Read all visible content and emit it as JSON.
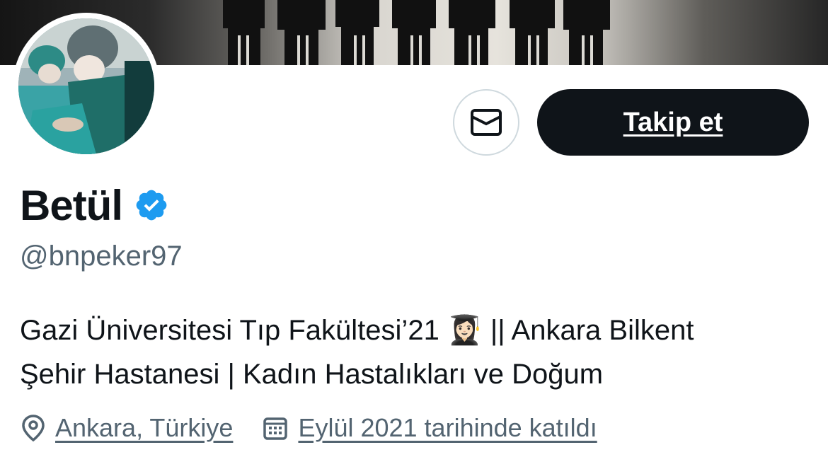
{
  "profile": {
    "display_name": "Betül",
    "handle": "@bnpeker97",
    "verified_icon": "verified-badge-icon",
    "bio_line1": "Gazi Üniversitesi Tıp Fakültesi’21 👩🏻‍🎓 || Ankara Bilkent",
    "bio_line2": "Şehir Hastanesi | Kadın Hastalıkları ve Doğum",
    "location": "Ankara, Türkiye",
    "joined": "Eylül 2021 tarihinde katıldı"
  },
  "actions": {
    "follow_label": "Takip et",
    "message_icon": "envelope-icon"
  },
  "icons": {
    "location": "location-pin-icon",
    "calendar": "calendar-icon"
  },
  "colors": {
    "verified": "#1d9bf0",
    "primary_text": "#0f1419",
    "secondary_text": "#536471",
    "follow_bg": "#0f1419"
  }
}
